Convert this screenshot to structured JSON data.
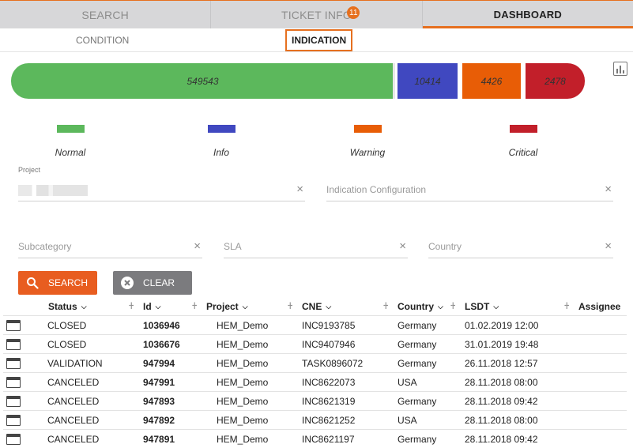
{
  "top_tabs": [
    {
      "label": "SEARCH"
    },
    {
      "label": "TICKET INFO",
      "badge": "11"
    },
    {
      "label": "DASHBOARD"
    }
  ],
  "sub_tabs": [
    {
      "label": "CONDITION"
    },
    {
      "label": "INDICATION"
    }
  ],
  "distribution": {
    "normal": "549543",
    "info": "10414",
    "warning": "4426",
    "critical": "2478"
  },
  "colors": {
    "normal": "#5cb85c",
    "info": "#4048c0",
    "warning": "#e85d06",
    "critical": "#c21f2a",
    "accent": "#e6701f"
  },
  "legend": [
    "Normal",
    "Info",
    "Warning",
    "Critical"
  ],
  "fields": {
    "project_label": "Project",
    "indication_configuration": "Indication Configuration",
    "subcategory": "Subcategory",
    "sla": "SLA",
    "country": "Country"
  },
  "buttons": {
    "search": "SEARCH",
    "clear": "CLEAR"
  },
  "table": {
    "columns": [
      "Status",
      "Id",
      "Project",
      "CNE",
      "Country",
      "LSDT",
      "Assignee"
    ],
    "rows": [
      [
        "CLOSED",
        "1036946",
        "HEM_Demo",
        "INC9193785",
        "Germany",
        "01.02.2019 12:00"
      ],
      [
        "CLOSED",
        "1036676",
        "HEM_Demo",
        "INC9407946",
        "Germany",
        "31.01.2019 19:48"
      ],
      [
        "VALIDATION",
        "947994",
        "HEM_Demo",
        "TASK0896072",
        "Germany",
        "26.11.2018 12:57"
      ],
      [
        "CANCELED",
        "947991",
        "HEM_Demo",
        "INC8622073",
        "USA",
        "28.11.2018 08:00"
      ],
      [
        "CANCELED",
        "947893",
        "HEM_Demo",
        "INC8621319",
        "Germany",
        "28.11.2018 09:42"
      ],
      [
        "CANCELED",
        "947892",
        "HEM_Demo",
        "INC8621252",
        "USA",
        "28.11.2018 08:00"
      ],
      [
        "CANCELED",
        "947891",
        "HEM_Demo",
        "INC8621197",
        "Germany",
        "28.11.2018 09:42"
      ]
    ]
  }
}
